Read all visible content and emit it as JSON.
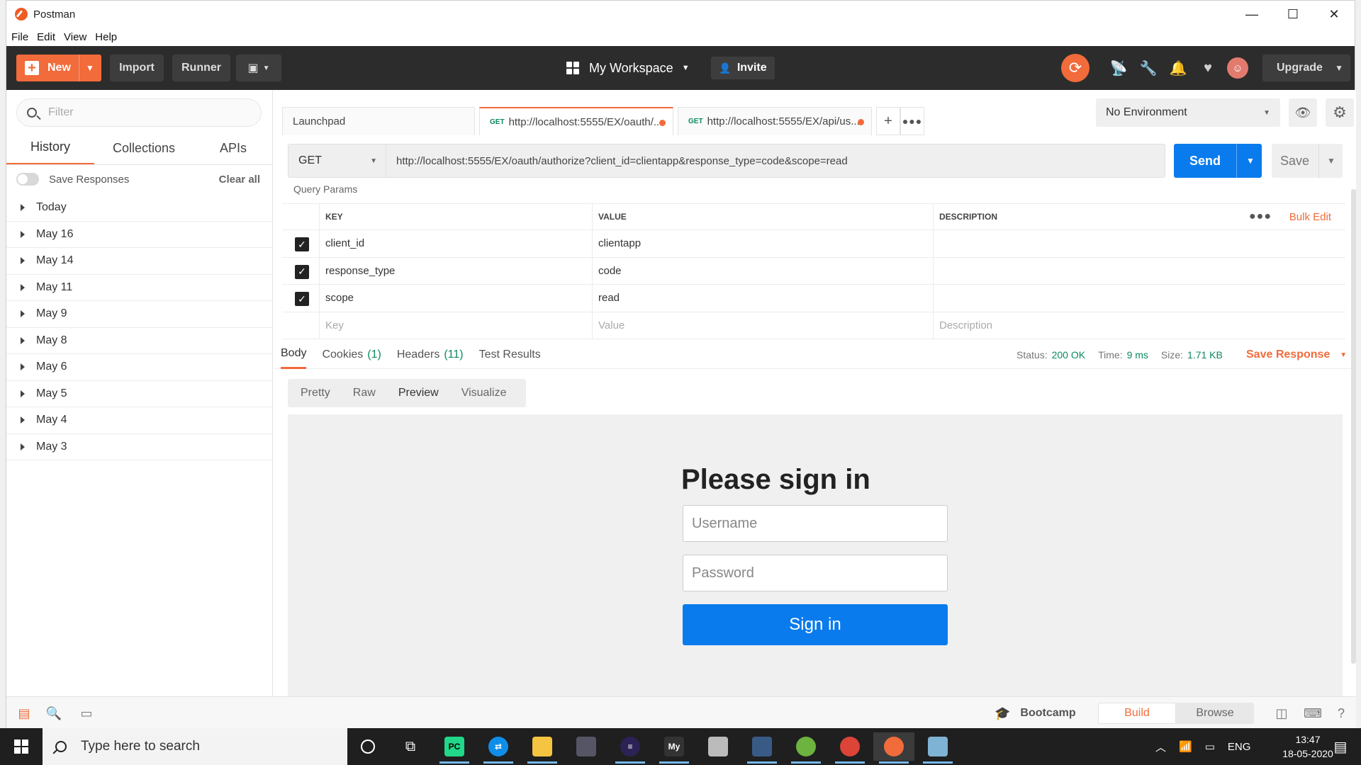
{
  "window": {
    "title": "Postman",
    "minimize": "—",
    "maximize": "☐",
    "close": "✕"
  },
  "menu": [
    "File",
    "Edit",
    "View",
    "Help"
  ],
  "header": {
    "new_label": "New",
    "import_label": "Import",
    "runner_label": "Runner",
    "workspace_label": "My Workspace",
    "invite_label": "Invite",
    "upgrade_label": "Upgrade",
    "accent": "#f26b3a",
    "icons": [
      "sync-icon",
      "satellite-icon",
      "wrench-icon",
      "bell-icon",
      "heart-icon",
      "avatar"
    ]
  },
  "sidebar": {
    "filter_placeholder": "Filter",
    "tabs": [
      "History",
      "Collections",
      "APIs"
    ],
    "active_tab": "History",
    "save_responses_label": "Save Responses",
    "clear_all_label": "Clear all",
    "history": [
      "Today",
      "May 16",
      "May 14",
      "May 11",
      "May 9",
      "May 8",
      "May 6",
      "May 5",
      "May 4",
      "May 3"
    ]
  },
  "request_tabs": [
    {
      "method": "",
      "label": "Launchpad"
    },
    {
      "method": "GET",
      "label": "http://localhost:5555/EX/oauth/..."
    },
    {
      "method": "GET",
      "label": "http://localhost:5555/EX/api/us..."
    }
  ],
  "environment": {
    "label": "No Environment"
  },
  "request": {
    "method": "GET",
    "url": "http://localhost:5555/EX/oauth/authorize?client_id=clientapp&response_type=code&scope=read",
    "send_label": "Send",
    "save_label": "Save"
  },
  "params": {
    "title": "Query Params",
    "headers": {
      "key": "KEY",
      "value": "VALUE",
      "description": "DESCRIPTION",
      "bulk_edit": "Bulk Edit"
    },
    "rows": [
      {
        "key": "client_id",
        "value": "clientapp",
        "checked": true
      },
      {
        "key": "response_type",
        "value": "code",
        "checked": true
      },
      {
        "key": "scope",
        "value": "read",
        "checked": true
      }
    ],
    "placeholder": {
      "key": "Key",
      "value": "Value",
      "description": "Description"
    }
  },
  "response": {
    "tabs": [
      {
        "label": "Body",
        "count": ""
      },
      {
        "label": "Cookies",
        "count": "(1)"
      },
      {
        "label": "Headers",
        "count": "(11)"
      },
      {
        "label": "Test Results",
        "count": ""
      }
    ],
    "status_label": "Status:",
    "status_value": "200 OK",
    "time_label": "Time:",
    "time_value": "9 ms",
    "size_label": "Size:",
    "size_value": "1.71 KB",
    "save_response_label": "Save Response",
    "view_tabs": [
      "Pretty",
      "Raw",
      "Preview",
      "Visualize"
    ],
    "active_view": "Preview"
  },
  "preview": {
    "title": "Please sign in",
    "username_placeholder": "Username",
    "password_placeholder": "Password",
    "button_label": "Sign in",
    "button_color": "#097bed"
  },
  "footer": {
    "bootcamp_label": "Bootcamp",
    "build_label": "Build",
    "browse_label": "Browse"
  },
  "taskbar": {
    "search_placeholder": "Type here to search",
    "language": "ENG",
    "time": "13:47",
    "date": "18-05-2020"
  }
}
